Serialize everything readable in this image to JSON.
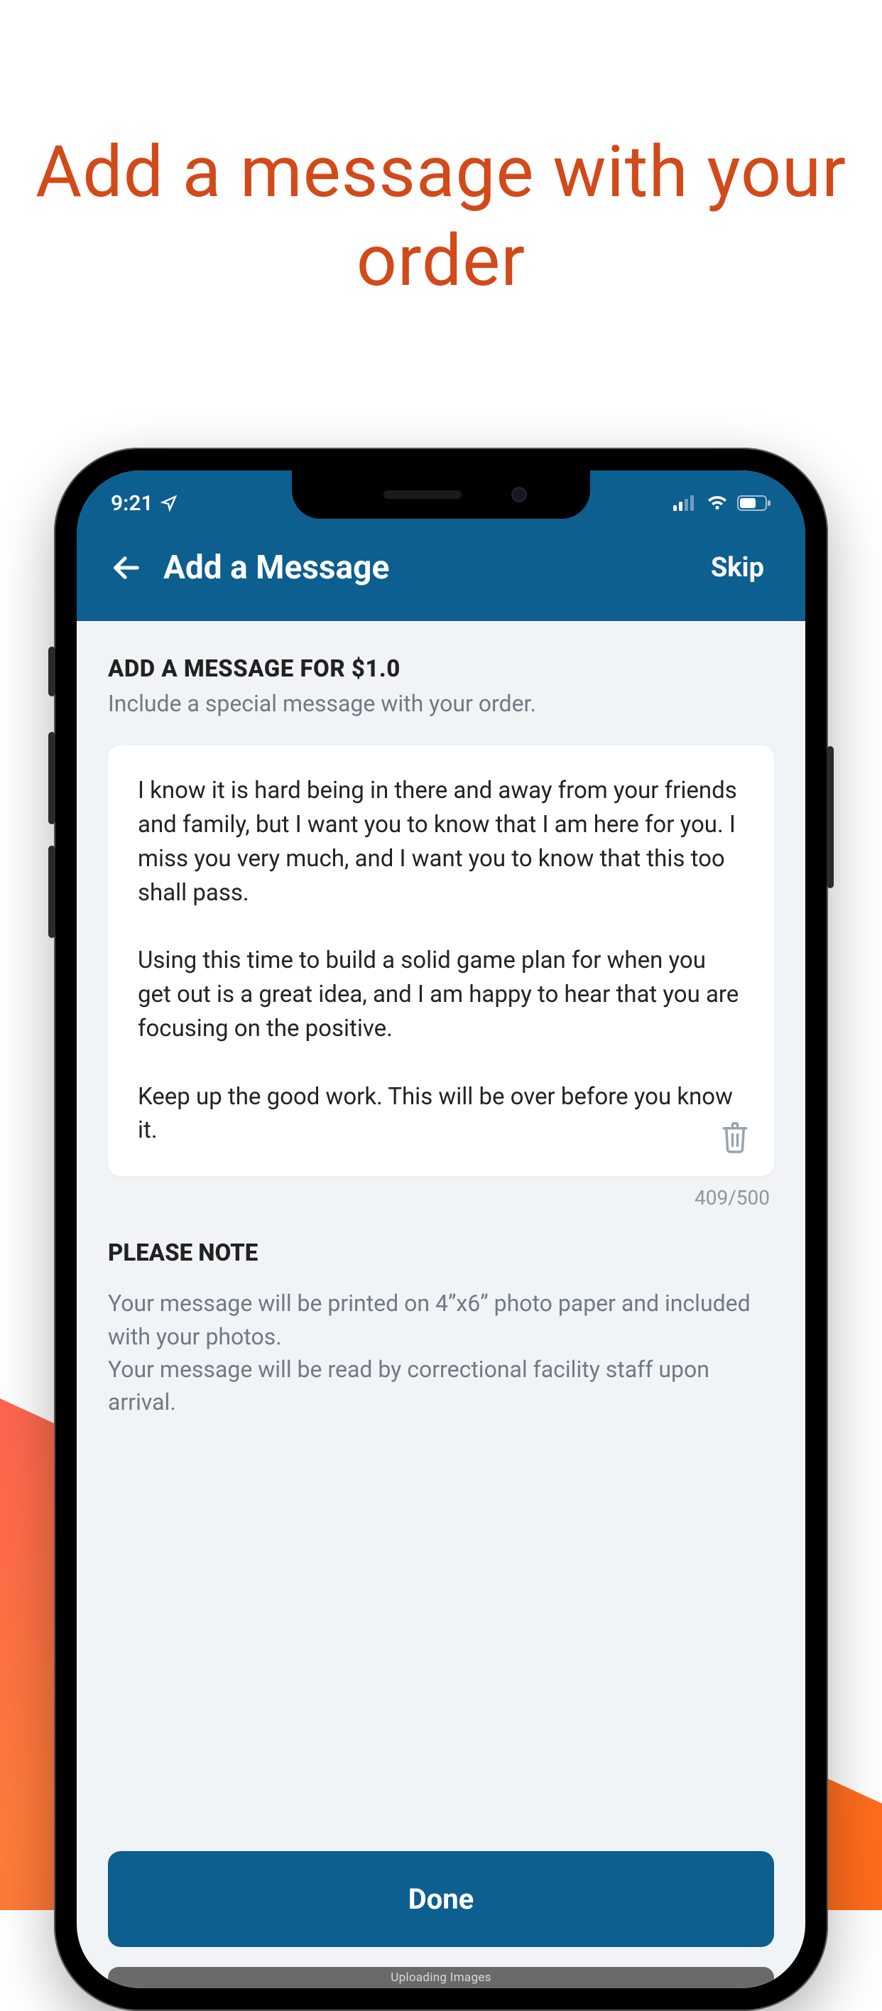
{
  "promo": {
    "title": "Add a message\nwith your order"
  },
  "status": {
    "time": "9:21"
  },
  "nav": {
    "title": "Add a Message",
    "skip_label": "Skip"
  },
  "section": {
    "title": "ADD A MESSAGE FOR $1.0",
    "subtitle": "Include a special message with your order."
  },
  "message": {
    "text": "I know it is hard being in there and away from your friends and family, but I want you to know that I am here for you. I miss you very much, and I want you to know that this too shall pass.\n\nUsing this time to build a solid game plan for when you get out is a great idea, and I am happy to hear that you are focusing on the positive.\n\nKeep up the good work. This will be over before you know it.",
    "counter": "409/500"
  },
  "note": {
    "title": "PLEASE NOTE",
    "body": "Your message will be printed on 4”x6” photo paper and included with your photos.\nYour message will be read by correctional facility staff upon arrival."
  },
  "footer": {
    "done_label": "Done",
    "progress_label": "Uploading Images"
  },
  "colors": {
    "accent_blue": "#0d5f8f",
    "promo_orange": "#d24a1a"
  }
}
